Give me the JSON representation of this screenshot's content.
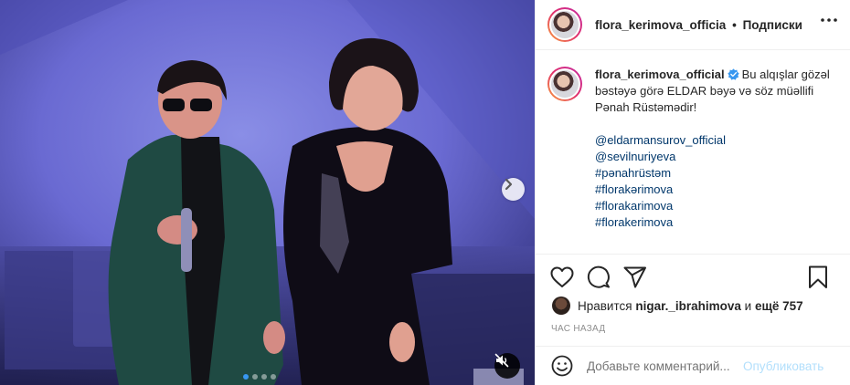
{
  "post": {
    "username": "flora_kerimova_officia",
    "separator": "•",
    "follow_label": "Подписки",
    "caption_username": "flora_kerimova_official",
    "caption_text": "Bu alqışlar gözəl bəstəyə görə ELDAR bəyə və söz müəllifi Pənah Rüstəmədir!",
    "tags": [
      "@eldarmansurov_official",
      "@sevilnuriyeva",
      "#pənahrüstəm",
      "#florakərimova",
      "#florakarimova",
      "#florakerimova"
    ],
    "likes_prefix": "Нравится",
    "likes_user": "nigar._ibrahimova",
    "likes_and": "и",
    "likes_count": "ещё 757",
    "time": "ЧАС НАЗАД",
    "comment_placeholder": "Добавьте комментарий...",
    "publish_label": "Опубликовать"
  },
  "media": {
    "carousel_total": 4,
    "carousel_current": 1
  },
  "icons": {
    "more": "more-icon",
    "heart": "heart-icon",
    "comment": "comment-icon",
    "share": "share-icon",
    "bookmark": "bookmark-icon",
    "next": "chevron-right-icon",
    "mute": "mute-icon",
    "emoji": "emoji-icon",
    "verified": "verified-icon"
  },
  "colors": {
    "link": "#00376b",
    "muted": "#8e8e8e",
    "publish": "#b2dffc",
    "verified": "#3897f0"
  }
}
